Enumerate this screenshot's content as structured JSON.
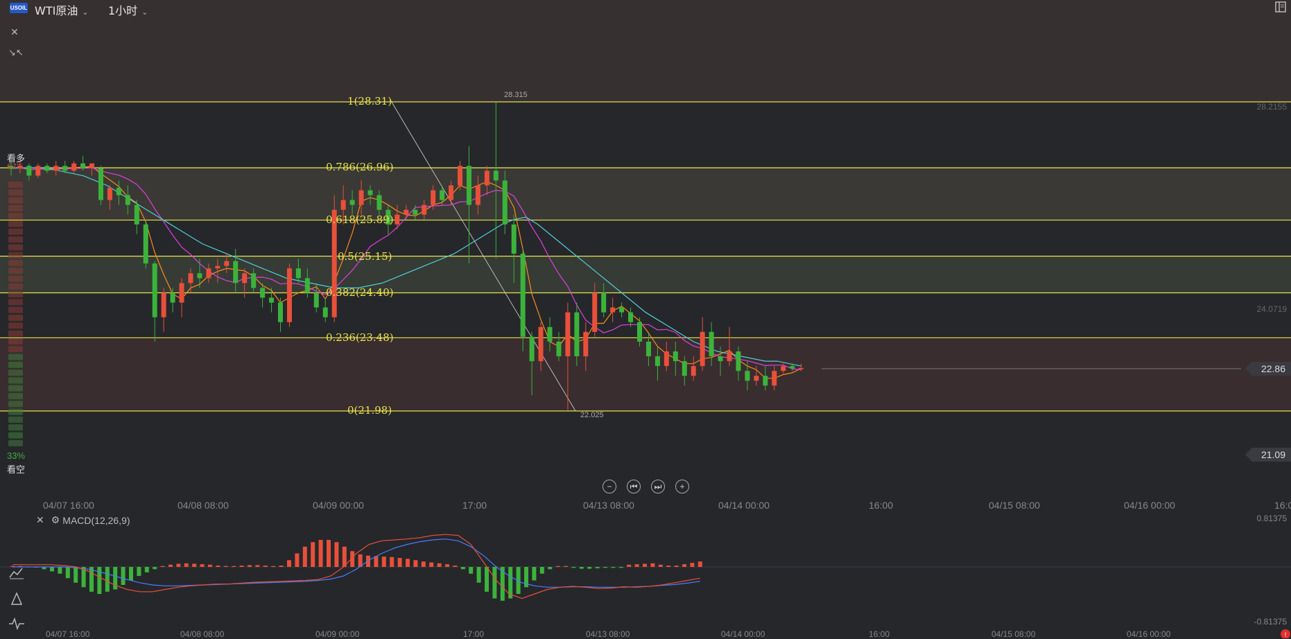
{
  "header": {
    "logo_text": "USOIL",
    "symbol": "WTI原油",
    "interval": "1小时"
  },
  "sentiment": {
    "bull_label": "看多",
    "bull_pct": "67%",
    "bear_pct": "33%",
    "bear_label": "看空"
  },
  "fibonacci": [
    {
      "label": "1(28.31)",
      "level": 28.31
    },
    {
      "label": "0.786(26.96)",
      "level": 26.96
    },
    {
      "label": "0.618(25.89)",
      "level": 25.89
    },
    {
      "label": "0.5(25.15)",
      "level": 25.15
    },
    {
      "label": "0.382(24.40)",
      "level": 24.4
    },
    {
      "label": "0.236(23.48)",
      "level": 23.48
    },
    {
      "label": "0(21.98)",
      "level": 21.98
    }
  ],
  "annotations": {
    "high": "28.315",
    "low": "22.025"
  },
  "price_axis": {
    "top": "28.2155",
    "mid": "24.0719",
    "current": "22.86",
    "bottom_tag": "21.09"
  },
  "time_axis": [
    "04/07 16:00",
    "04/08 08:00",
    "04/09 00:00",
    "17:00",
    "04/13 08:00",
    "04/14 00:00",
    "16:00",
    "04/15 08:00",
    "04/16 00:00",
    "16:0"
  ],
  "time_axis_bottom": [
    "04/07 16:00",
    "04/08 08:00",
    "04/09 00:00",
    "17:00",
    "04/13 08:00",
    "04/14 00:00",
    "16:00",
    "04/15 08:00",
    "04/16 00:00"
  ],
  "macd": {
    "title": "MACD(12,26,9)",
    "axis_top": "0.81375",
    "axis_bottom": "-0.81375"
  },
  "colors": {
    "up": "#e8503a",
    "down": "#3bb33b",
    "fib": "#e8e34a",
    "ma_orange": "#ff8c1a",
    "ma_magenta": "#e040e0",
    "ma_cyan": "#4fd0d8",
    "macd_blue": "#4a7dff",
    "macd_red": "#e8503a"
  },
  "chart_data": {
    "type": "candlestick",
    "title": "WTI原油 1小时",
    "ylim": [
      20.6,
      29.9
    ],
    "candles": [
      [
        27.0,
        27.1,
        26.8,
        26.95
      ],
      [
        26.95,
        27.1,
        26.85,
        27.0
      ],
      [
        27.0,
        27.05,
        26.7,
        26.8
      ],
      [
        26.8,
        27.05,
        26.75,
        27.0
      ],
      [
        27.0,
        27.05,
        26.85,
        26.9
      ],
      [
        26.9,
        27.1,
        26.8,
        27.0
      ],
      [
        27.0,
        27.1,
        26.85,
        26.9
      ],
      [
        26.9,
        27.1,
        26.85,
        27.05
      ],
      [
        27.05,
        27.2,
        26.9,
        26.95
      ],
      [
        26.95,
        27.05,
        26.8,
        27.05
      ],
      [
        26.95,
        27.0,
        26.2,
        26.3
      ],
      [
        26.3,
        26.6,
        26.1,
        26.55
      ],
      [
        26.55,
        26.7,
        26.2,
        26.4
      ],
      [
        26.4,
        26.6,
        26.0,
        26.2
      ],
      [
        26.2,
        26.3,
        25.6,
        25.8
      ],
      [
        25.8,
        25.9,
        24.9,
        25.0
      ],
      [
        25.0,
        25.05,
        23.4,
        23.9
      ],
      [
        23.9,
        24.5,
        23.6,
        24.4
      ],
      [
        24.4,
        24.5,
        24.0,
        24.2
      ],
      [
        24.2,
        24.7,
        23.9,
        24.6
      ],
      [
        24.6,
        24.9,
        24.4,
        24.8
      ],
      [
        24.8,
        25.1,
        24.5,
        24.7
      ],
      [
        24.7,
        25.0,
        24.6,
        24.9
      ],
      [
        24.9,
        25.1,
        24.6,
        24.95
      ],
      [
        24.95,
        25.2,
        24.8,
        25.05
      ],
      [
        25.05,
        25.3,
        24.4,
        24.6
      ],
      [
        24.6,
        24.9,
        24.3,
        24.8
      ],
      [
        24.8,
        24.9,
        24.4,
        24.5
      ],
      [
        24.5,
        24.6,
        24.1,
        24.3
      ],
      [
        24.3,
        24.5,
        24.0,
        24.2
      ],
      [
        24.2,
        24.3,
        23.6,
        23.8
      ],
      [
        23.8,
        25.0,
        23.7,
        24.9
      ],
      [
        24.9,
        25.1,
        24.6,
        24.7
      ],
      [
        24.7,
        24.9,
        24.3,
        24.4
      ],
      [
        24.4,
        24.6,
        24.0,
        24.1
      ],
      [
        24.1,
        24.3,
        23.8,
        23.9
      ],
      [
        23.9,
        26.4,
        23.8,
        26.1
      ],
      [
        26.1,
        26.6,
        25.8,
        26.3
      ],
      [
        26.3,
        26.5,
        26.0,
        26.2
      ],
      [
        26.2,
        26.7,
        26.0,
        26.5
      ],
      [
        26.5,
        26.6,
        26.2,
        26.4
      ],
      [
        26.4,
        26.5,
        26.0,
        26.1
      ],
      [
        26.1,
        26.2,
        25.6,
        25.8
      ],
      [
        25.8,
        26.2,
        25.7,
        26.0
      ],
      [
        26.0,
        26.2,
        25.9,
        26.1
      ],
      [
        26.1,
        26.2,
        25.9,
        26.0
      ],
      [
        26.0,
        26.3,
        25.9,
        26.2
      ],
      [
        26.2,
        26.6,
        26.1,
        26.5
      ],
      [
        26.5,
        26.6,
        26.2,
        26.3
      ],
      [
        26.3,
        26.7,
        26.2,
        26.6
      ],
      [
        26.6,
        27.1,
        26.5,
        27.0
      ],
      [
        27.0,
        27.4,
        25.0,
        26.2
      ],
      [
        26.2,
        26.8,
        26.0,
        26.6
      ],
      [
        26.6,
        27.0,
        26.4,
        26.9
      ],
      [
        26.9,
        28.3,
        25.1,
        26.7
      ],
      [
        26.7,
        26.9,
        25.6,
        25.8
      ],
      [
        25.8,
        26.0,
        24.6,
        25.2
      ],
      [
        25.2,
        25.3,
        23.2,
        23.5
      ],
      [
        23.5,
        23.6,
        22.3,
        23.0
      ],
      [
        23.0,
        23.8,
        22.8,
        23.7
      ],
      [
        23.7,
        23.9,
        23.2,
        23.4
      ],
      [
        23.4,
        23.6,
        23.0,
        23.1
      ],
      [
        23.1,
        24.2,
        22.0,
        24.0
      ],
      [
        24.0,
        24.2,
        22.9,
        23.1
      ],
      [
        23.1,
        23.8,
        22.8,
        23.6
      ],
      [
        23.6,
        24.6,
        23.5,
        24.4
      ],
      [
        24.4,
        24.6,
        23.9,
        24.0
      ],
      [
        24.0,
        24.3,
        23.8,
        24.1
      ],
      [
        24.1,
        24.2,
        23.9,
        24.0
      ],
      [
        24.0,
        24.1,
        23.7,
        23.8
      ],
      [
        23.8,
        23.9,
        23.3,
        23.4
      ],
      [
        23.4,
        23.6,
        22.9,
        23.1
      ],
      [
        23.1,
        23.3,
        22.6,
        22.9
      ],
      [
        22.9,
        23.4,
        22.8,
        23.2
      ],
      [
        23.2,
        23.4,
        22.7,
        23.0
      ],
      [
        23.0,
        23.1,
        22.5,
        22.7
      ],
      [
        22.7,
        23.1,
        22.6,
        22.9
      ],
      [
        22.9,
        23.9,
        22.8,
        23.6
      ],
      [
        23.6,
        23.8,
        22.9,
        23.1
      ],
      [
        23.1,
        23.3,
        22.7,
        23.0
      ],
      [
        23.0,
        23.7,
        22.9,
        23.2
      ],
      [
        23.2,
        23.3,
        22.6,
        22.8
      ],
      [
        22.8,
        23.0,
        22.4,
        22.6
      ],
      [
        22.6,
        22.9,
        22.5,
        22.7
      ],
      [
        22.7,
        22.9,
        22.4,
        22.5
      ],
      [
        22.5,
        22.9,
        22.4,
        22.8
      ],
      [
        22.8,
        22.95,
        22.75,
        22.9
      ],
      [
        22.9,
        22.95,
        22.8,
        22.85
      ],
      [
        22.85,
        22.95,
        22.8,
        22.86
      ]
    ],
    "ma_cyan": [
      26.95,
      26.96,
      26.96,
      26.95,
      26.9,
      26.85,
      26.8,
      26.7,
      26.6,
      26.45,
      26.3,
      26.15,
      26.0,
      25.85,
      25.7,
      25.55,
      25.4,
      25.3,
      25.2,
      25.1,
      25.0,
      24.9,
      24.8,
      24.7,
      24.65,
      24.6,
      24.55,
      24.5,
      24.5,
      24.5,
      24.55,
      24.6,
      24.7,
      24.8,
      24.9,
      25.0,
      25.1,
      25.2,
      25.35,
      25.5,
      25.65,
      25.8,
      25.9,
      25.95,
      25.8,
      25.6,
      25.4,
      25.2,
      25.0,
      24.8,
      24.6,
      24.4,
      24.2,
      24.0,
      23.85,
      23.7,
      23.55,
      23.4,
      23.3,
      23.2,
      23.15,
      23.1,
      23.05,
      23.0,
      23.0,
      22.95,
      22.9
    ],
    "macd_hist": [
      0.02,
      0.02,
      0.01,
      0.0,
      -0.05,
      -0.1,
      -0.15,
      -0.25,
      -0.35,
      -0.45,
      -0.55,
      -0.6,
      -0.55,
      -0.5,
      -0.4,
      -0.3,
      -0.2,
      -0.12,
      -0.05,
      0.02,
      0.05,
      0.07,
      0.08,
      0.07,
      0.06,
      0.05,
      0.03,
      0.02,
      0.02,
      0.03,
      0.04,
      0.04,
      0.03,
      0.02,
      0.03,
      0.15,
      0.3,
      0.45,
      0.55,
      0.6,
      0.6,
      0.55,
      0.45,
      0.35,
      0.28,
      0.25,
      0.24,
      0.23,
      0.22,
      0.2,
      0.18,
      0.15,
      0.12,
      0.1,
      0.08,
      0.06,
      0.03,
      -0.05,
      -0.15,
      -0.35,
      -0.55,
      -0.7,
      -0.75,
      -0.7,
      -0.6,
      -0.45,
      -0.3,
      -0.15,
      -0.05,
      0.02,
      0.02,
      -0.02,
      -0.04,
      -0.04,
      -0.03,
      -0.02,
      -0.02,
      -0.02,
      0.05,
      0.06,
      0.07,
      0.08,
      0.05,
      0.03,
      0.03,
      0.06,
      0.09,
      0.12
    ],
    "macd_line": [
      0.05,
      0.05,
      0.05,
      0.05,
      0.03,
      0.0,
      -0.1,
      -0.25,
      -0.4,
      -0.5,
      -0.55,
      -0.55,
      -0.5,
      -0.45,
      -0.42,
      -0.4,
      -0.38,
      -0.38,
      -0.36,
      -0.34,
      -0.33,
      -0.32,
      -0.31,
      -0.3,
      -0.28,
      -0.2,
      0.0,
      0.3,
      0.5,
      0.58,
      0.6,
      0.62,
      0.65,
      0.7,
      0.72,
      0.7,
      0.5,
      0.1,
      -0.3,
      -0.6,
      -0.7,
      -0.6,
      -0.5,
      -0.45,
      -0.43,
      -0.45,
      -0.48,
      -0.47,
      -0.44,
      -0.45,
      -0.43,
      -0.4,
      -0.35,
      -0.3,
      -0.25
    ],
    "signal_line": [
      0.0,
      0.0,
      0.0,
      0.0,
      0.0,
      -0.02,
      -0.05,
      -0.12,
      -0.2,
      -0.28,
      -0.35,
      -0.4,
      -0.42,
      -0.42,
      -0.41,
      -0.4,
      -0.39,
      -0.38,
      -0.37,
      -0.36,
      -0.35,
      -0.34,
      -0.33,
      -0.32,
      -0.3,
      -0.27,
      -0.2,
      -0.05,
      0.15,
      0.3,
      0.42,
      0.5,
      0.56,
      0.6,
      0.62,
      0.58,
      0.45,
      0.25,
      0.0,
      -0.2,
      -0.35,
      -0.42,
      -0.45,
      -0.45,
      -0.44,
      -0.44,
      -0.45,
      -0.45,
      -0.45,
      -0.44,
      -0.43,
      -0.41,
      -0.39,
      -0.36,
      -0.32
    ]
  }
}
